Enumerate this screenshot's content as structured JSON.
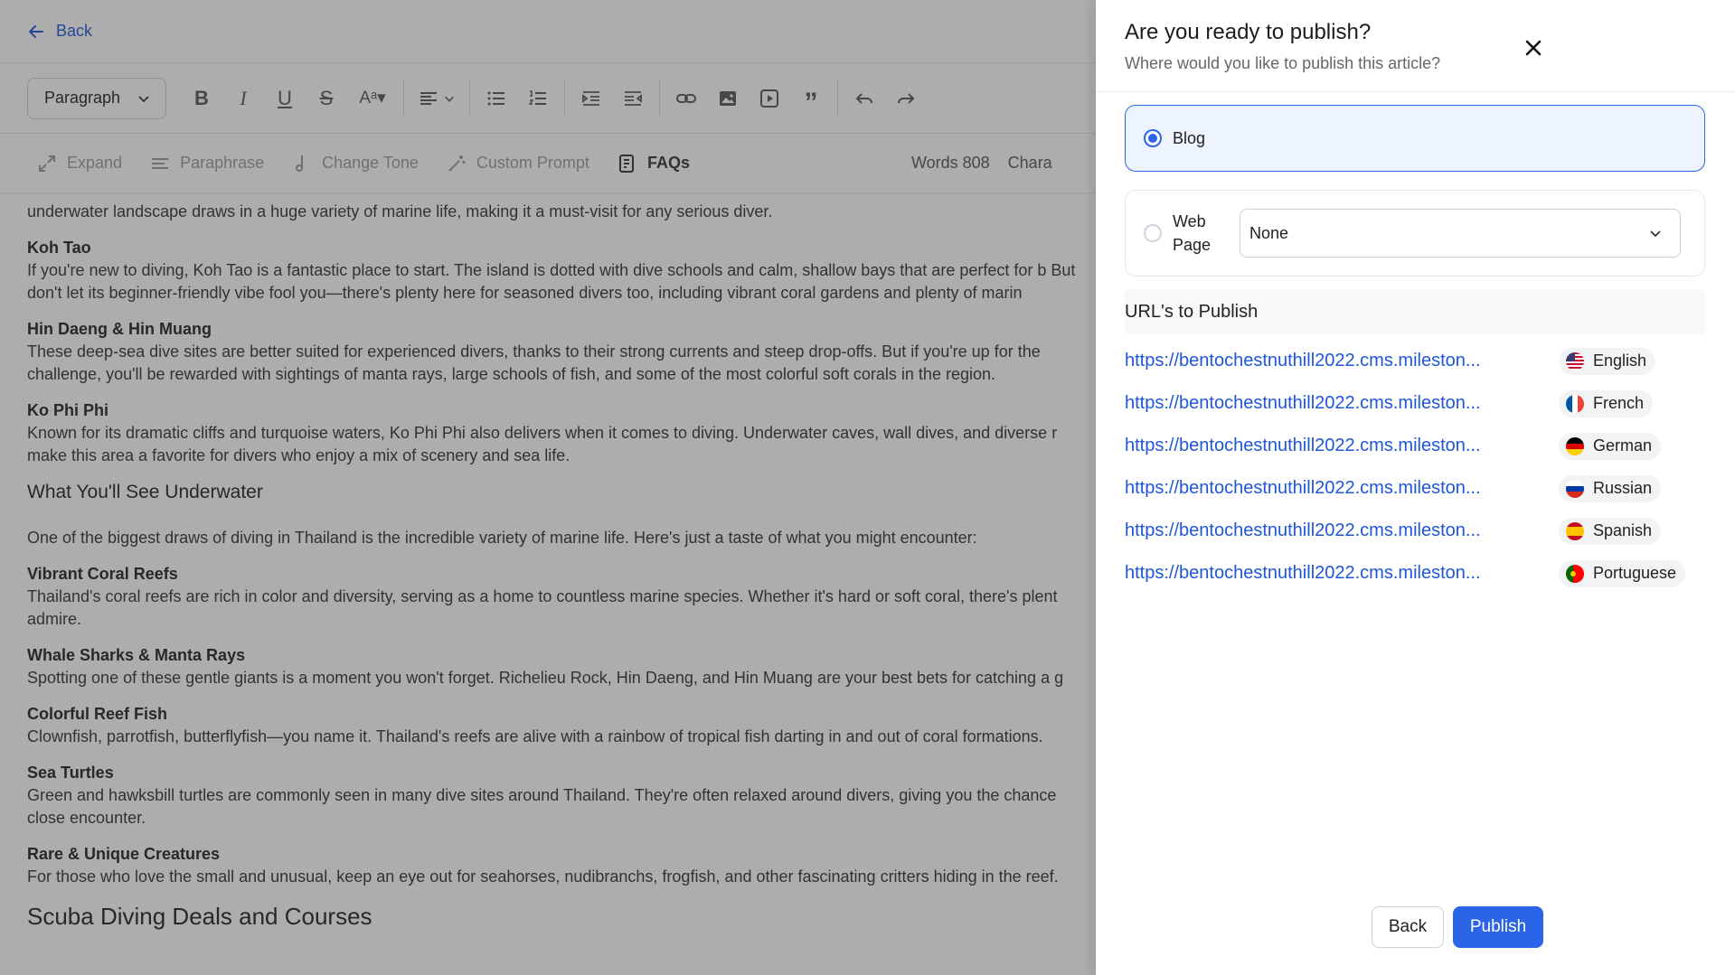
{
  "editor": {
    "back_label": "Back",
    "paragraph_select": "Paragraph",
    "ai_tools": [
      {
        "label": "Expand",
        "icon": "expand-icon"
      },
      {
        "label": "Paraphrase",
        "icon": "paraphrase-icon"
      },
      {
        "label": "Change Tone",
        "icon": "music-note-icon"
      },
      {
        "label": "Custom Prompt",
        "icon": "magic-wand-icon"
      },
      {
        "label": "FAQs",
        "icon": "faq-icon"
      }
    ],
    "words_label": "Words 808",
    "chars_label": "Chara",
    "content": {
      "intro": "underwater landscape draws in a huge variety of marine life, making it a must-visit for any serious diver.",
      "koh_tao_title": "Koh Tao",
      "koh_tao_text": "If you're new to diving, Koh Tao is a fantastic place to start. The island is dotted with dive schools and calm, shallow bays that are perfect for b But don't let its beginner-friendly vibe fool you—there's plenty here for seasoned divers too, including vibrant coral gardens and plenty of marin",
      "hin_daeng_title": "Hin Daeng & Hin Muang",
      "hin_daeng_text": "These deep-sea dive sites are better suited for experienced divers, thanks to their strong currents and steep drop-offs. But if you're up for the challenge, you'll be rewarded with sightings of manta rays, large schools of fish, and some of the most colorful soft corals in the region.",
      "ko_phi_phi_title": "Ko Phi Phi",
      "ko_phi_phi_text": "Known for its dramatic cliffs and turquoise waters, Ko Phi Phi also delivers when it comes to diving. Underwater caves, wall dives, and diverse r make this area a favorite for divers who enjoy a mix of scenery and sea life.",
      "see_heading": "What You'll See Underwater",
      "see_intro": "One of the biggest draws of diving in Thailand is the incredible variety of marine life. Here's just a taste of what you might encounter:",
      "coral_title": "Vibrant Coral Reefs",
      "coral_text": "Thailand's coral reefs are rich in color and diversity, serving as a home to countless marine species. Whether it's hard or soft coral, there's plent admire.",
      "whale_title": "Whale Sharks & Manta Rays",
      "whale_text": "Spotting one of these gentle giants is a moment you won't forget. Richelieu Rock, Hin Daeng, and Hin Muang are your best bets for catching a g",
      "reef_title": "Colorful Reef Fish",
      "reef_text": "Clownfish, parrotfish, butterflyfish—you name it. Thailand's reefs are alive with a rainbow of tropical fish darting in and out of coral formations.",
      "turtle_title": "Sea Turtles",
      "turtle_text": "Green and hawksbill turtles are commonly seen in many dive sites around Thailand. They're often relaxed around divers, giving you the chance close encounter.",
      "rare_title": "Rare & Unique Creatures",
      "rare_text": "For those who love the small and unusual, keep an eye out for seahorses, nudibranchs, frogfish, and other fascinating critters hiding in the reef.",
      "deals_heading": "Scuba Diving Deals and Courses"
    }
  },
  "publish_panel": {
    "title": "Are you ready to publish?",
    "subtitle": "Where would you like to publish this article?",
    "option_blog": "Blog",
    "option_webpage": "Web Page",
    "webpage_select": "None",
    "urls_heading": "URL's to Publish",
    "urls": [
      {
        "url": "https://bentochestnuthill2022.cms.mileston...",
        "language": "English",
        "flag": "us-flag"
      },
      {
        "url": "https://bentochestnuthill2022.cms.mileston...",
        "language": "French",
        "flag": "fr-flag"
      },
      {
        "url": "https://bentochestnuthill2022.cms.mileston...",
        "language": "German",
        "flag": "de-flag"
      },
      {
        "url": "https://bentochestnuthill2022.cms.mileston...",
        "language": "Russian",
        "flag": "ru-flag"
      },
      {
        "url": "https://bentochestnuthill2022.cms.mileston...",
        "language": "Spanish",
        "flag": "es-flag"
      },
      {
        "url": "https://bentochestnuthill2022.cms.mileston...",
        "language": "Portuguese",
        "flag": "pt-flag"
      }
    ],
    "back_button": "Back",
    "publish_button": "Publish"
  },
  "colors": {
    "accent": "#2c64e8",
    "link": "#1f56d8",
    "overlay": "#7a7a7a"
  }
}
